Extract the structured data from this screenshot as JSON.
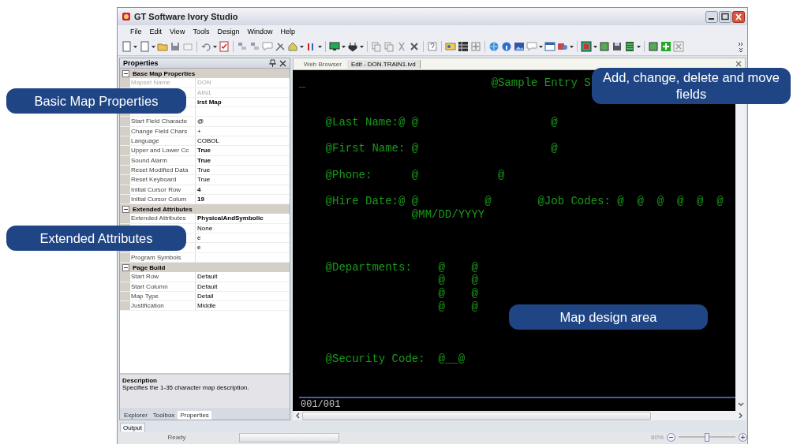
{
  "window": {
    "title": "GT Software Ivory Studio"
  },
  "menu": [
    "File",
    "Edit",
    "View",
    "Tools",
    "Design",
    "Window",
    "Help"
  ],
  "properties_panel": {
    "title": "Properties",
    "sections": [
      {
        "title": "Base Map Properties",
        "expanded": true,
        "rows": [
          {
            "name": "Mapset Name",
            "value": "DON",
            "readonly": true,
            "modified": false
          },
          {
            "value": "AIN1",
            "readonly": true,
            "modified": false
          },
          {
            "value": "irst Map",
            "readonly": false,
            "modified": true
          },
          {},
          {
            "name": "Start Field Characte",
            "value": "@",
            "readonly": false,
            "modified": false
          },
          {
            "name": "Change Field Chars",
            "value": "+",
            "readonly": false,
            "modified": false
          },
          {
            "name": "Language",
            "value": "COBOL",
            "readonly": false,
            "modified": false
          },
          {
            "name": "Upper and Lower Cc",
            "value": "True",
            "readonly": false,
            "modified": true
          },
          {
            "name": "Sound Alarm",
            "value": "True",
            "readonly": false,
            "modified": true
          },
          {
            "name": "Reset Modified Data",
            "value": "True",
            "readonly": false,
            "modified": false
          },
          {
            "name": "Reset Keyboard",
            "value": "True",
            "readonly": false,
            "modified": false
          },
          {
            "name": "Initial Cursor Row",
            "value": "4",
            "readonly": false,
            "modified": true
          },
          {
            "name": "Initial Cursor Colum",
            "value": "19",
            "readonly": false,
            "modified": true
          }
        ]
      },
      {
        "title": "Extended Attributes",
        "expanded": true,
        "rows": [
          {
            "name": "Extended Attributes",
            "value": "PhysicalAndSymbolic",
            "readonly": false,
            "modified": true
          },
          {
            "value": "None",
            "readonly": false,
            "modified": false
          },
          {
            "value": "e",
            "readonly": false,
            "modified": false
          },
          {
            "value": "e",
            "readonly": false,
            "modified": false
          },
          {
            "name": "Program Symbols",
            "readonly": false
          }
        ]
      },
      {
        "title": "Page Build",
        "expanded": true,
        "rows": [
          {
            "name": "Start Row",
            "value": "Default",
            "readonly": false,
            "modified": false
          },
          {
            "name": "Start Column",
            "value": "Default",
            "readonly": false,
            "modified": false
          },
          {
            "name": "Map Type",
            "value": "Detail",
            "readonly": false,
            "modified": false
          },
          {
            "name": "Justification",
            "value": "Middle",
            "readonly": false,
            "modified": false
          }
        ]
      }
    ],
    "description": {
      "title": "Description",
      "text": "Specifies the 1-35 character map description."
    },
    "tabs": [
      {
        "label": "Explorer",
        "selected": false
      },
      {
        "label": "Toolbox",
        "selected": false
      },
      {
        "label": "Properties",
        "selected": true
      }
    ]
  },
  "document_tabs": [
    {
      "label": "Web Browser",
      "selected": false
    },
    {
      "label": "Edit - DON.TRAIN1.ivd",
      "selected": true
    }
  ],
  "map_screen": {
    "text": "_                            @Sample Entry S\n\n\n    @Last Name:@ @                    @\n\n    @First Name: @                    @\n\n    @Phone:      @            @\n\n    @Hire Date:@ @          @       @Job Codes: @  @  @  @  @  @\n                 @MM/DD/YYYY\n\n\n\n    @Departments:    @    @\n                     @    @\n                     @    @\n                     @    @\n\n\n\n    @Security Code:  @__@",
    "page_indicator": "001/001"
  },
  "bottom_tabs": [
    {
      "label": "Output",
      "selected": true
    }
  ],
  "status_bar": {
    "text": "Ready",
    "zoom": "80%",
    "level": 0.5
  },
  "callouts": [
    {
      "text": "Basic Map Properties"
    },
    {
      "text": "Extended Attributes"
    },
    {
      "text": "Add, change, delete and move fields"
    },
    {
      "text": "Map design area"
    }
  ]
}
